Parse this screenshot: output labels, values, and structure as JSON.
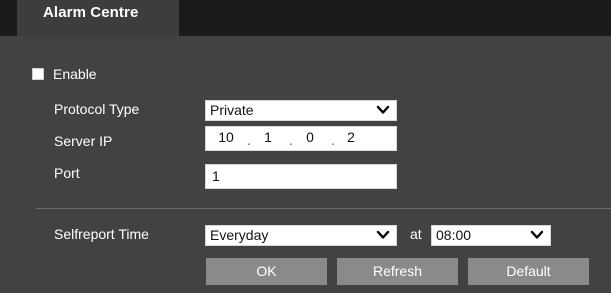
{
  "tabs": [
    {
      "label": "Alarm Centre",
      "active": true
    }
  ],
  "form": {
    "enable": {
      "label": "Enable",
      "checked": false
    },
    "protocol_type": {
      "label": "Protocol Type",
      "value": "Private"
    },
    "server_ip": {
      "label": "Server IP",
      "octets": [
        "10",
        "1",
        "0",
        "2"
      ]
    },
    "port": {
      "label": "Port",
      "value": "1"
    },
    "selfreport_time": {
      "label": "Selfreport Time",
      "day_value": "Everyday",
      "at_label": "at",
      "time_value": "08:00"
    }
  },
  "buttons": {
    "ok": "OK",
    "refresh": "Refresh",
    "default": "Default"
  },
  "colors": {
    "background": "#424242",
    "tab_bar": "#1b1b1b",
    "button": "#8a8a8a",
    "text": "#ffffff"
  },
  "icons": {
    "dropdown": "chevron-down-icon"
  }
}
